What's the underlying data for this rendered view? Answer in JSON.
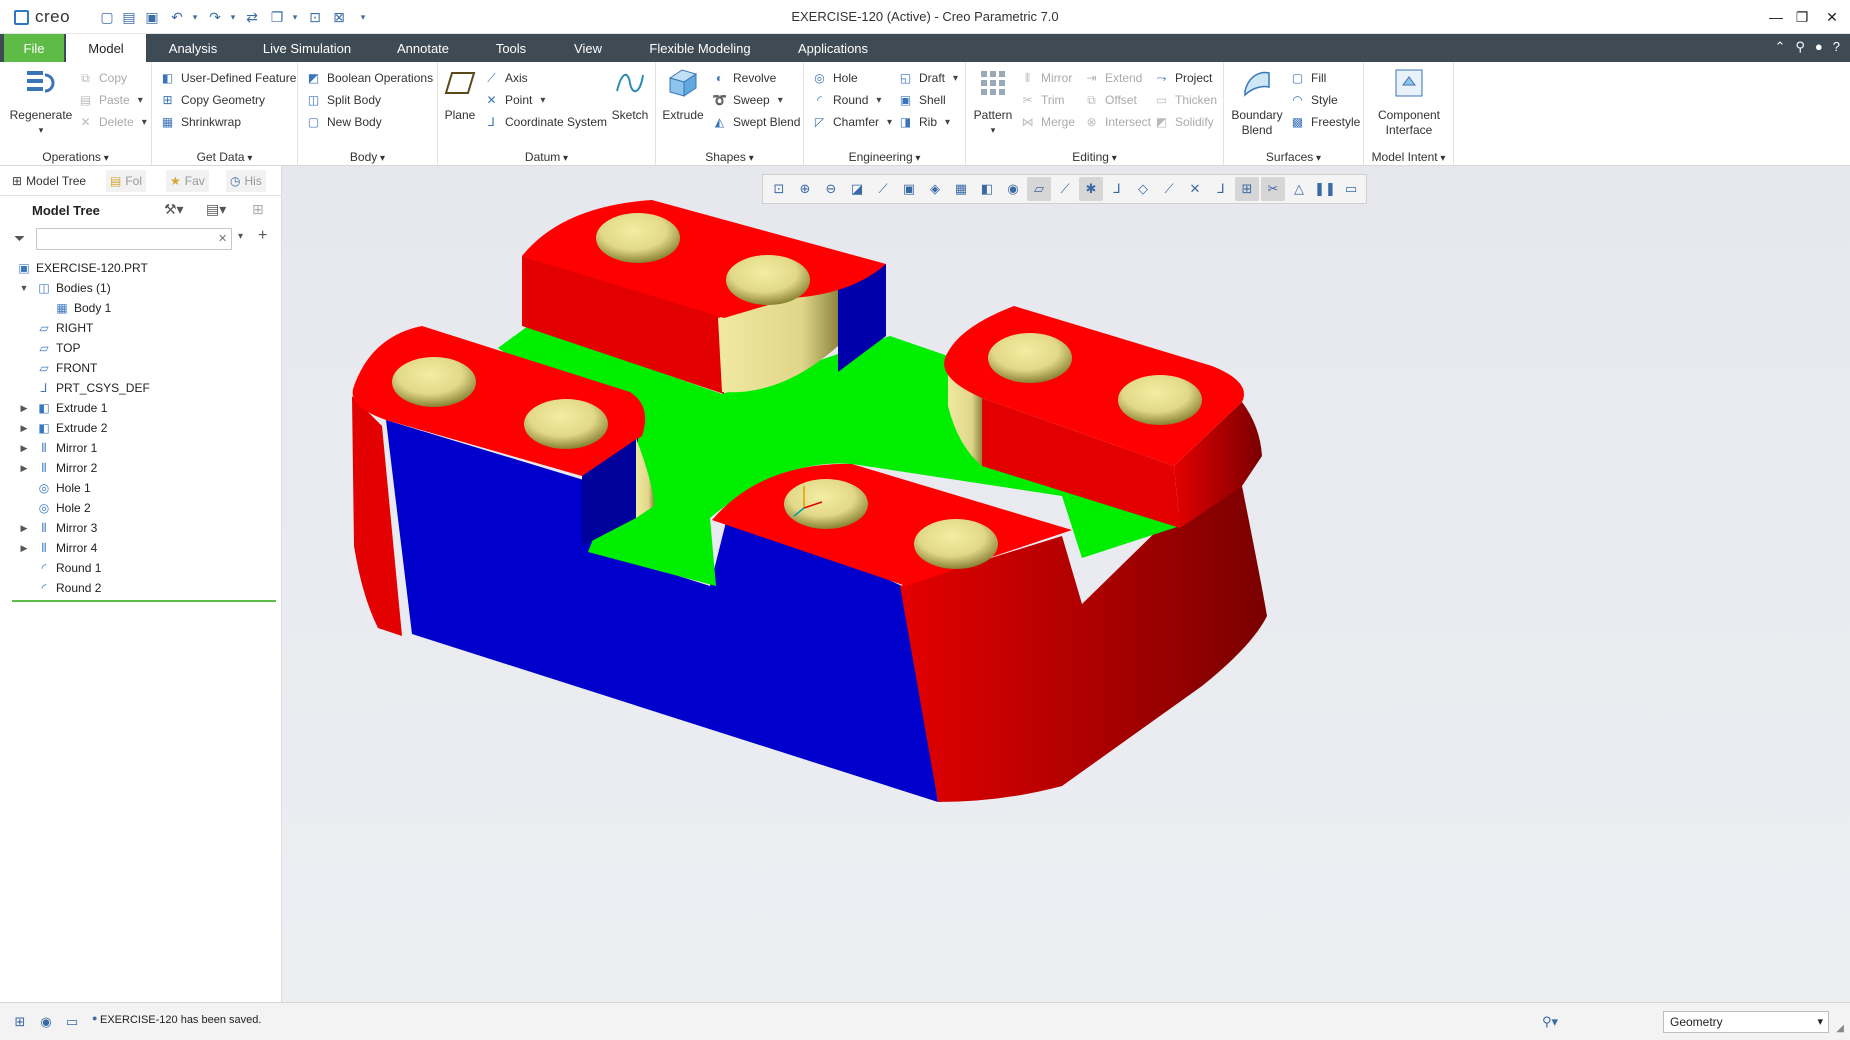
{
  "app": {
    "logo": "creo",
    "window_title": "EXERCISE-120 (Active) - Creo Parametric 7.0"
  },
  "tabs": [
    "File",
    "Model",
    "Analysis",
    "Live Simulation",
    "Annotate",
    "Tools",
    "View",
    "Flexible Modeling",
    "Applications"
  ],
  "active_tab": "Model",
  "ribbon": {
    "operations": {
      "label": "Operations",
      "regenerate": "Regenerate",
      "copy": "Copy",
      "paste": "Paste",
      "delete": "Delete"
    },
    "get_data": {
      "label": "Get Data",
      "user_defined_feature": "User-Defined Feature",
      "copy_geometry": "Copy Geometry",
      "shrinkwrap": "Shrinkwrap"
    },
    "body": {
      "label": "Body",
      "boolean_operations": "Boolean Operations",
      "split_body": "Split Body",
      "new_body": "New Body"
    },
    "datum": {
      "label": "Datum",
      "plane": "Plane",
      "axis": "Axis",
      "point": "Point",
      "coordinate_system": "Coordinate System",
      "sketch": "Sketch"
    },
    "shapes": {
      "label": "Shapes",
      "extrude": "Extrude",
      "revolve": "Revolve",
      "sweep": "Sweep",
      "swept_blend": "Swept Blend"
    },
    "engineering": {
      "label": "Engineering",
      "hole": "Hole",
      "round": "Round",
      "chamfer": "Chamfer",
      "draft": "Draft",
      "shell": "Shell",
      "rib": "Rib"
    },
    "editing": {
      "label": "Editing",
      "pattern": "Pattern",
      "mirror": "Mirror",
      "trim": "Trim",
      "merge": "Merge",
      "extend": "Extend",
      "offset": "Offset",
      "intersect": "Intersect",
      "project": "Project",
      "thicken": "Thicken",
      "solidify": "Solidify"
    },
    "surfaces": {
      "label": "Surfaces",
      "boundary_blend_1": "Boundary",
      "boundary_blend_2": "Blend",
      "fill": "Fill",
      "style": "Style",
      "freestyle": "Freestyle"
    },
    "model_intent": {
      "label": "Model Intent",
      "component_interface_1": "Component",
      "component_interface_2": "Interface"
    }
  },
  "panel": {
    "tabs": {
      "model_tree": "Model Tree",
      "folder": "Fol",
      "favorites": "Fav",
      "history": "His"
    },
    "header": "Model Tree",
    "search_value": "",
    "tree": [
      {
        "label": "EXERCISE-120.PRT",
        "icon": "part-icon",
        "level": 0,
        "expander": ""
      },
      {
        "label": "Bodies (1)",
        "icon": "bodies-icon",
        "level": 0,
        "expander": "open"
      },
      {
        "label": "Body 1",
        "icon": "body-icon",
        "level": 1,
        "expander": ""
      },
      {
        "label": "RIGHT",
        "icon": "datum-plane-icon",
        "level": 0,
        "expander": ""
      },
      {
        "label": "TOP",
        "icon": "datum-plane-icon",
        "level": 0,
        "expander": ""
      },
      {
        "label": "FRONT",
        "icon": "datum-plane-icon",
        "level": 0,
        "expander": ""
      },
      {
        "label": "PRT_CSYS_DEF",
        "icon": "csys-icon",
        "level": 0,
        "expander": ""
      },
      {
        "label": "Extrude 1",
        "icon": "extrude-icon",
        "level": 0,
        "expander": "closed"
      },
      {
        "label": "Extrude 2",
        "icon": "extrude-icon",
        "level": 0,
        "expander": "closed"
      },
      {
        "label": "Mirror 1",
        "icon": "mirror-icon",
        "level": 0,
        "expander": "closed"
      },
      {
        "label": "Mirror 2",
        "icon": "mirror-icon",
        "level": 0,
        "expander": "closed"
      },
      {
        "label": "Hole 1",
        "icon": "hole-icon",
        "level": 0,
        "expander": ""
      },
      {
        "label": "Hole 2",
        "icon": "hole-icon",
        "level": 0,
        "expander": ""
      },
      {
        "label": "Mirror 3",
        "icon": "mirror-icon",
        "level": 0,
        "expander": "closed"
      },
      {
        "label": "Mirror 4",
        "icon": "mirror-icon",
        "level": 0,
        "expander": "closed"
      },
      {
        "label": "Round 1",
        "icon": "round-icon",
        "level": 0,
        "expander": ""
      },
      {
        "label": "Round 2",
        "icon": "round-icon",
        "level": 0,
        "expander": ""
      }
    ]
  },
  "status": {
    "message": "EXERCISE-120 has been saved.",
    "selection_filter": "Geometry"
  },
  "colors": {
    "accent": "#5dbb46",
    "tabbar": "#3e4b54",
    "face_top": "#ff0000",
    "face_side": "#0000cc",
    "face_floor": "#00ee00",
    "hole": "#e8e090"
  }
}
